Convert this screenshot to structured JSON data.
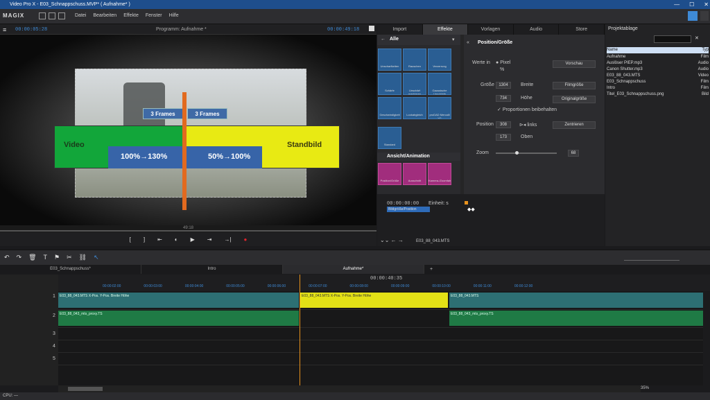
{
  "window": {
    "title": "Video Pro X - E03_Schnappschuss.MVP* ( Aufnahme* )"
  },
  "menu": {
    "logo": "MAGIX",
    "items": [
      "Datei",
      "Bearbeiten",
      "Effekte",
      "Fenster",
      "Hilfe"
    ]
  },
  "preview": {
    "timecode_left": "00:00:05:28",
    "title": "Programm: Aufnahme *",
    "timecode_right": "00:00:49:18",
    "scrub_label": "49:18"
  },
  "overlay": {
    "label_video": "Video",
    "label_standbild": "Standbild",
    "frames_left": "3 Frames",
    "frames_right": "3 Frames",
    "pct_left": "100%→130%",
    "pct_right": "50%→100%"
  },
  "right_tabs": [
    "Import",
    "Effekte",
    "Vorlagen",
    "Audio",
    "Store"
  ],
  "effects": {
    "category": "Alle",
    "tiles": [
      "Unscharfkeiten",
      "Rauschen",
      "Verzerrung",
      "Schärfe",
      "Unschärf maskieren",
      "Gaussische Unschärfe",
      "Geschwindigkeit",
      "Lookabgleich",
      "proDAD Mercalli V2",
      "Standard"
    ],
    "section": "Ansicht/Animation",
    "anim_tiles": [
      "Position/Größe",
      "Ausschnitt",
      "Kamera-/Zoomfahrt"
    ]
  },
  "props": {
    "title": "Position/Größe",
    "werte_in": "Werte in",
    "pixel": "Pixel",
    "percent": "%",
    "vorschau": "Vorschau",
    "groesse": "Größe",
    "breite_val": "1304",
    "breite": "Breite",
    "filmgroesse": "Filmgröße",
    "hoehe_val": "734",
    "hoehe": "Höhe",
    "originalgroesse": "Originalgröße",
    "proportionen": "Proportionen beibehalten",
    "position": "Position",
    "links_val": "308",
    "links": "links",
    "zentrieren": "Zentrieren",
    "oben_val": "173",
    "oben": "Oben",
    "zoom": "Zoom",
    "zoom_val": "68"
  },
  "keyframe": {
    "time": "00:00:00:00",
    "einheit": "Einheit: s",
    "track": "Bildgröße/Position",
    "footer": "E03_88_043.MTS"
  },
  "project": {
    "title": "Projektablage",
    "col_name": "Name",
    "col_type": "Typ",
    "items": [
      {
        "name": "Aufnahme",
        "type": "Film"
      },
      {
        "name": "Auslöser PIEP.mp3",
        "type": "Audio"
      },
      {
        "name": "Canon Shutter.mp3",
        "type": "Audio"
      },
      {
        "name": "E03_88_043.MTS",
        "type": "Video"
      },
      {
        "name": "E03_Schnappschuss",
        "type": "Film"
      },
      {
        "name": "Intro",
        "type": "Film"
      },
      {
        "name": "Titel_E03_Schnappschuss.png",
        "type": "Bild"
      }
    ]
  },
  "timeline": {
    "tabs": [
      "E03_Schnappschuss*",
      "Intro",
      "Aufnahme*"
    ],
    "playhead": "00:00:40:35",
    "ticks": [
      "00:00:02:00",
      "00:00:03:00",
      "00:00:04:00",
      "00:00:05:00",
      "00:00:06:00",
      "00:00:07:00",
      "00:00:08:00",
      "00:00:09:00",
      "00:00:10:00",
      "00:00:11:00",
      "00:00:12:00",
      "00:00:13:00"
    ],
    "clip1": "E03_88_043.MTS X-Pos. Y-Pos. Breite Höhe",
    "clip2": "E03_88_043.MTS X-Pos. Y-Pos. Breite Höhe",
    "clip3": "E03_88_043.MTS",
    "audio1": "E03_88_043_mts_proxy.TS",
    "audio2": "E03_88_043_mts_proxy.TS",
    "zoom_pct": "35%",
    "tracks": [
      "1",
      "2",
      "3",
      "4",
      "5"
    ]
  },
  "status": {
    "cpu": "CPU: —"
  }
}
